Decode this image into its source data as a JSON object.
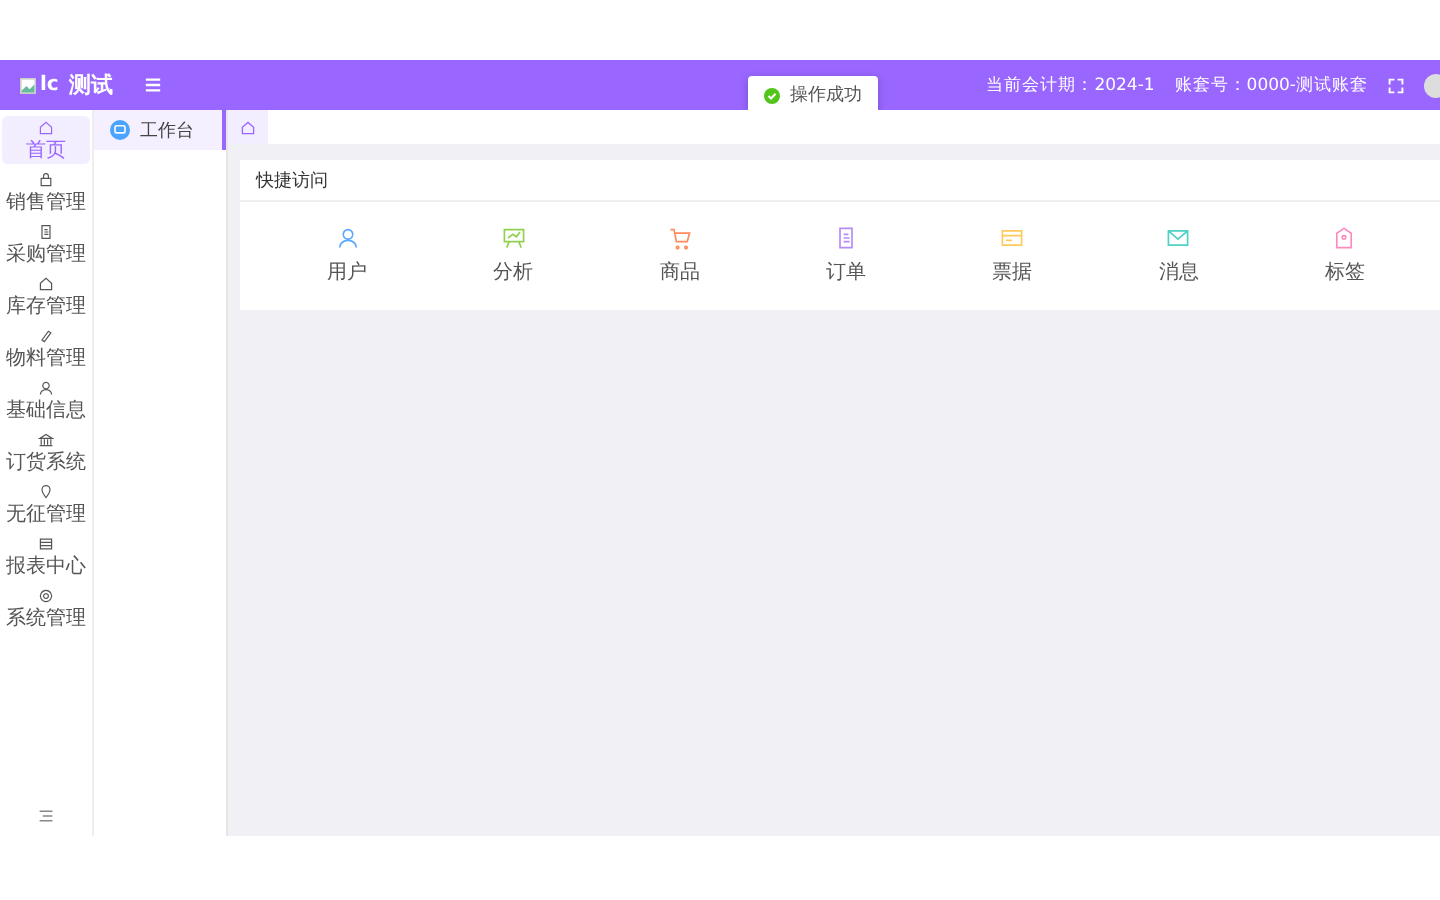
{
  "header": {
    "logo_alt": "lc",
    "title": "测试",
    "period": "当前会计期：2024-1",
    "account": "账套号：0000-测试账套"
  },
  "toast": {
    "text": "操作成功"
  },
  "rail": [
    {
      "label": "首页",
      "selected": true
    },
    {
      "label": "销售管理",
      "selected": false
    },
    {
      "label": "采购管理",
      "selected": false
    },
    {
      "label": "库存管理",
      "selected": false
    },
    {
      "label": "物料管理",
      "selected": false
    },
    {
      "label": "基础信息",
      "selected": false
    },
    {
      "label": "订货系统",
      "selected": false
    },
    {
      "label": "无征管理",
      "selected": false
    },
    {
      "label": "报表中心",
      "selected": false
    },
    {
      "label": "系统管理",
      "selected": false
    }
  ],
  "submenu": [
    {
      "label": "工作台",
      "selected": true
    }
  ],
  "quick_access": {
    "title": "快捷访问",
    "items": [
      {
        "label": "用户"
      },
      {
        "label": "分析"
      },
      {
        "label": "商品"
      },
      {
        "label": "订单"
      },
      {
        "label": "票据"
      },
      {
        "label": "消息"
      },
      {
        "label": "标签"
      }
    ]
  }
}
